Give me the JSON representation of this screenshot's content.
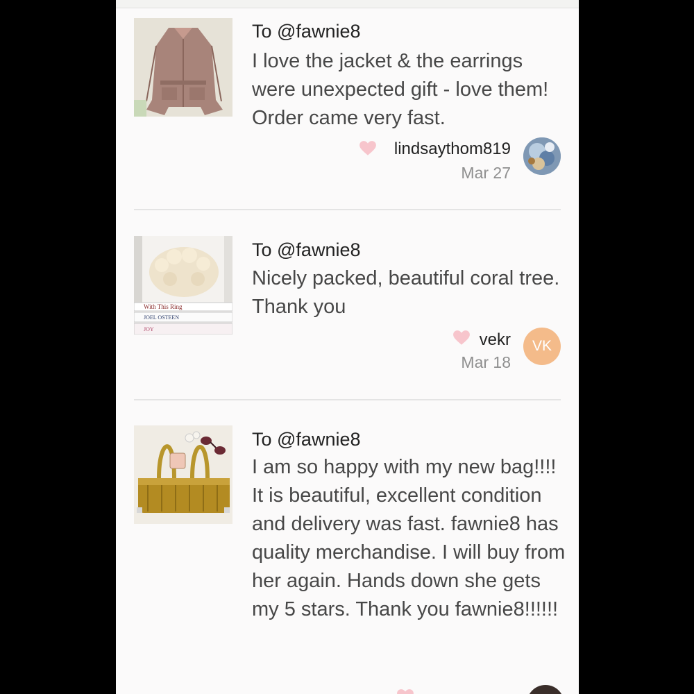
{
  "reviews": [
    {
      "to": "To @fawnie8",
      "text": "I love the jacket & the earrings were unexpected gift - love them! Order came very fast.",
      "username": "lindsaythom819",
      "date": "Mar 27",
      "thumb_icon": "jacket-photo",
      "avatar_icon": "floral-avatar"
    },
    {
      "to": "To @fawnie8",
      "text": "Nicely packed, beautiful coral tree. Thank you",
      "username": "vekr",
      "date": "Mar 18",
      "avatar_initials": "VK",
      "thumb_icon": "coral-photo",
      "book_titles": [
        "With This Ring",
        "JOEL OSTEEN",
        "JOY"
      ]
    },
    {
      "to": "To @fawnie8",
      "text": "I am so happy with my new bag!!!! It is beautiful, excellent condition and delivery was fast. fawnie8 has quality merchandise. I will buy from her again. Hands down she gets my 5 stars. Thank you fawnie8!!!!!!",
      "thumb_icon": "handbag-photo"
    }
  ],
  "colors": {
    "heart": "#f7c5cc",
    "avatar_vk": "#f4bb8a",
    "background": "#fbfafa"
  }
}
